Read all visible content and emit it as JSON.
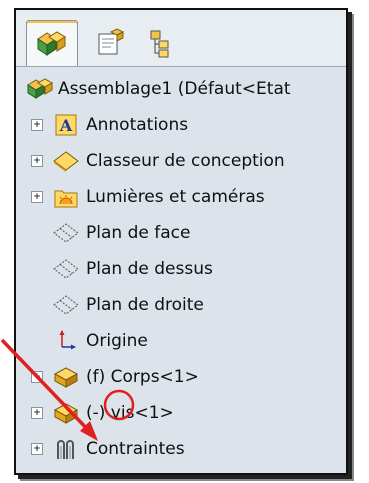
{
  "tabs": [
    {
      "name": "feature-manager-tab-icon"
    },
    {
      "name": "property-manager-tab-icon"
    },
    {
      "name": "configuration-manager-tab-icon"
    }
  ],
  "tree": {
    "root": {
      "label": "Assemblage1  (Défaut<Etat"
    },
    "items": [
      {
        "label": "Annotations",
        "expandable": true
      },
      {
        "label": "Classeur de conception",
        "expandable": true
      },
      {
        "label": "Lumières et caméras",
        "expandable": true
      },
      {
        "label": "Plan de face",
        "expandable": false
      },
      {
        "label": "Plan de dessus",
        "expandable": false
      },
      {
        "label": "Plan de droite",
        "expandable": false
      },
      {
        "label": "Origine",
        "expandable": false
      },
      {
        "label": "(f) Corps<1>",
        "expandable": true
      },
      {
        "label": "(-) vis<1>",
        "expandable": true
      },
      {
        "label": "Contraintes",
        "expandable": true
      }
    ],
    "expand_glyph": "+"
  },
  "annotation_color": "#e02020"
}
